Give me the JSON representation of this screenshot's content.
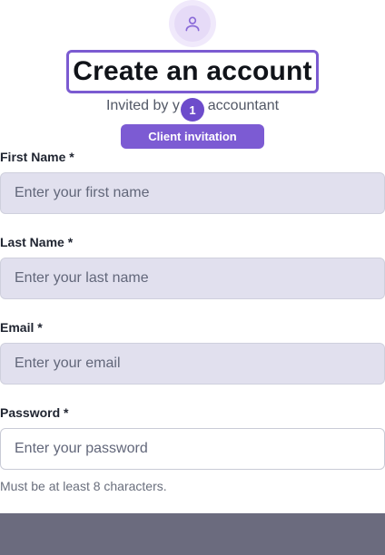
{
  "header": {
    "title": "Create an account",
    "subtitle_before": "Invited by y",
    "subtitle_after": "accountant",
    "step_badge": "1",
    "pill": "Client invitation",
    "avatar_icon": "user-icon"
  },
  "form": {
    "first_name": {
      "label": "First Name *",
      "placeholder": "Enter your first name"
    },
    "last_name": {
      "label": "Last Name *",
      "placeholder": "Enter your last name"
    },
    "email": {
      "label": "Email *",
      "placeholder": "Enter your email"
    },
    "password": {
      "label": "Password *",
      "placeholder": "Enter your password",
      "hint": "Must be at least 8 characters."
    }
  },
  "colors": {
    "accent": "#7c5bd3",
    "badge": "#6d4ccb",
    "input_bg": "#e1e0ee",
    "footer": "#6b6b7e"
  }
}
